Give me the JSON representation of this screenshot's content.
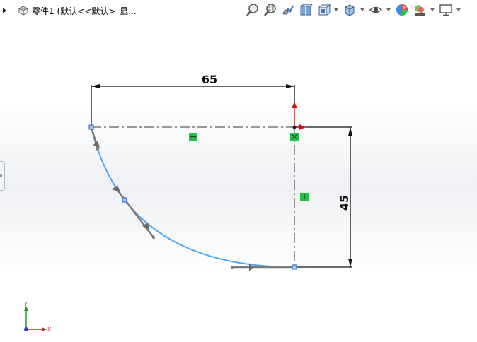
{
  "feature_tree": {
    "title": "零件1  (默认<<默认>_显..."
  },
  "toolbar": {
    "icons": [
      "zoom-to-fit-icon",
      "zoom-to-area-icon",
      "previous-view-icon",
      "section-view-icon",
      "view-orientation-icon",
      "display-style-icon",
      "hide-show-items-icon",
      "edit-appearance-icon",
      "apply-scene-icon",
      "view-settings-icon"
    ]
  },
  "sketch": {
    "dimension_horizontal": "65",
    "dimension_vertical": "45",
    "colors": {
      "arc": "#4da6f0",
      "construction": "#5f5f5f",
      "dimension": "#111111",
      "relation": "#22c24a",
      "point": "#3c78d8"
    }
  },
  "triad": {
    "x_label": "X",
    "y_label": "Y",
    "x_color": "#d42020",
    "y_color": "#1f9a2a",
    "z_color": "#2b3fd1"
  }
}
